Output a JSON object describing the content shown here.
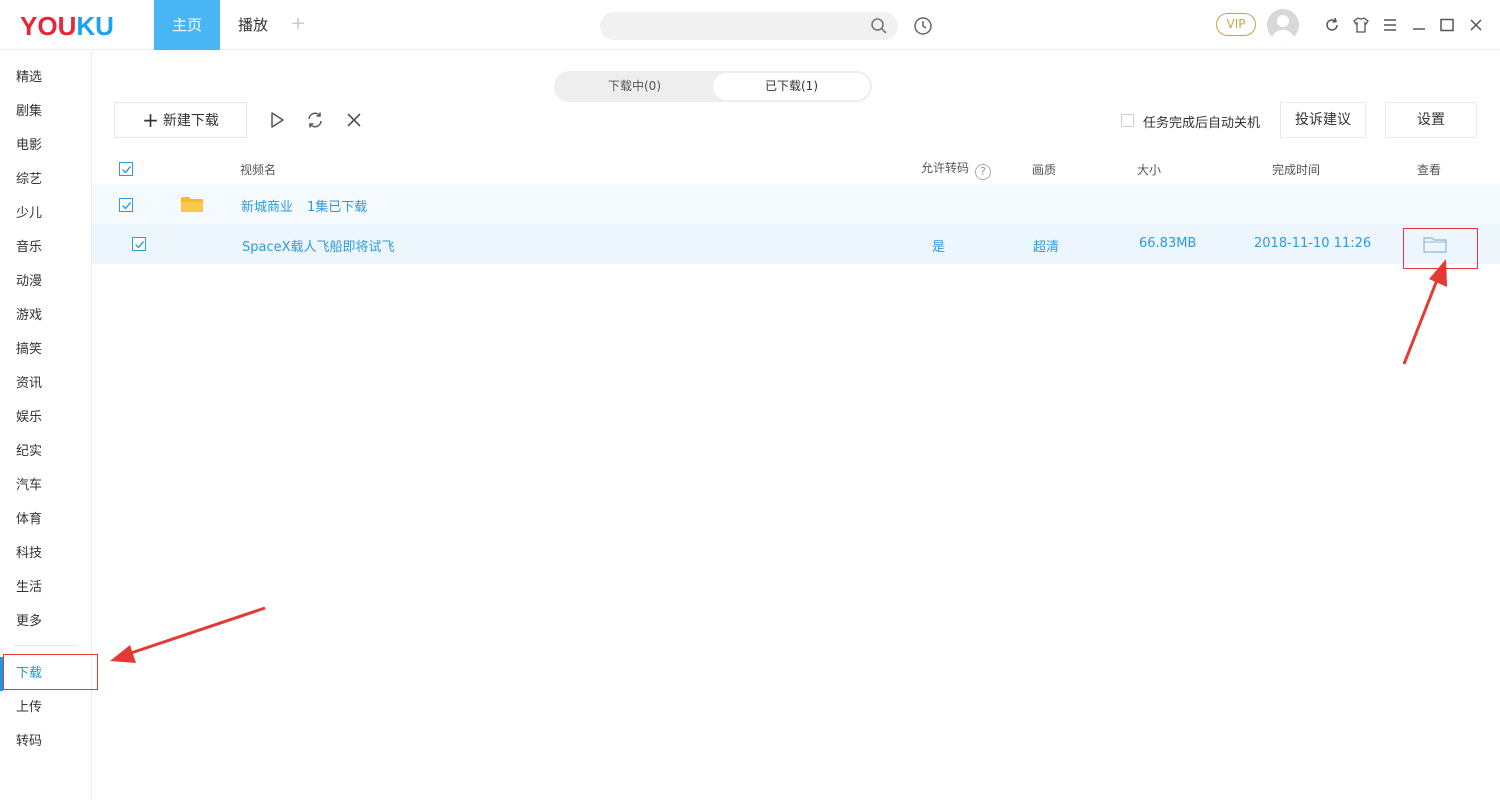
{
  "app": {
    "logo_you": "YOU",
    "logo_ku": "KU",
    "tabs": [
      {
        "label": "主页"
      },
      {
        "label": "播放"
      }
    ],
    "add_tab": "+",
    "vip": "VIP"
  },
  "sidebar": {
    "items": [
      "精选",
      "剧集",
      "电影",
      "综艺",
      "少儿",
      "音乐",
      "动漫",
      "游戏",
      "搞笑",
      "资讯",
      "娱乐",
      "纪实",
      "汽车",
      "体育",
      "科技",
      "生活",
      "更多"
    ],
    "bottom_items": [
      "下载",
      "上传",
      "转码"
    ],
    "active": "下载"
  },
  "download": {
    "tabs": [
      "下载中(0)",
      "已下载(1)"
    ],
    "active_tab": "已下载(1)",
    "new_download": "新建下载",
    "auto_shutdown_label": "任务完成后自动关机",
    "feedback": "投诉建议",
    "settings": "设置",
    "columns": {
      "name": "视频名",
      "transcode": "允许转码",
      "help": "?",
      "quality": "画质",
      "size": "大小",
      "finished": "完成时间",
      "view": "查看"
    },
    "group": {
      "name": "新城商业",
      "count": "1集已下载"
    },
    "items": [
      {
        "name": "SpaceX载人飞船即将试飞",
        "transcode": "是",
        "quality": "超清",
        "size": "66.83MB",
        "finished": "2018-11-10 11:26"
      }
    ]
  },
  "colors": {
    "accent": "#1a97e6",
    "highlight": "#e53935",
    "logo_red": "#e8263a",
    "folder": "#f5b82e"
  }
}
